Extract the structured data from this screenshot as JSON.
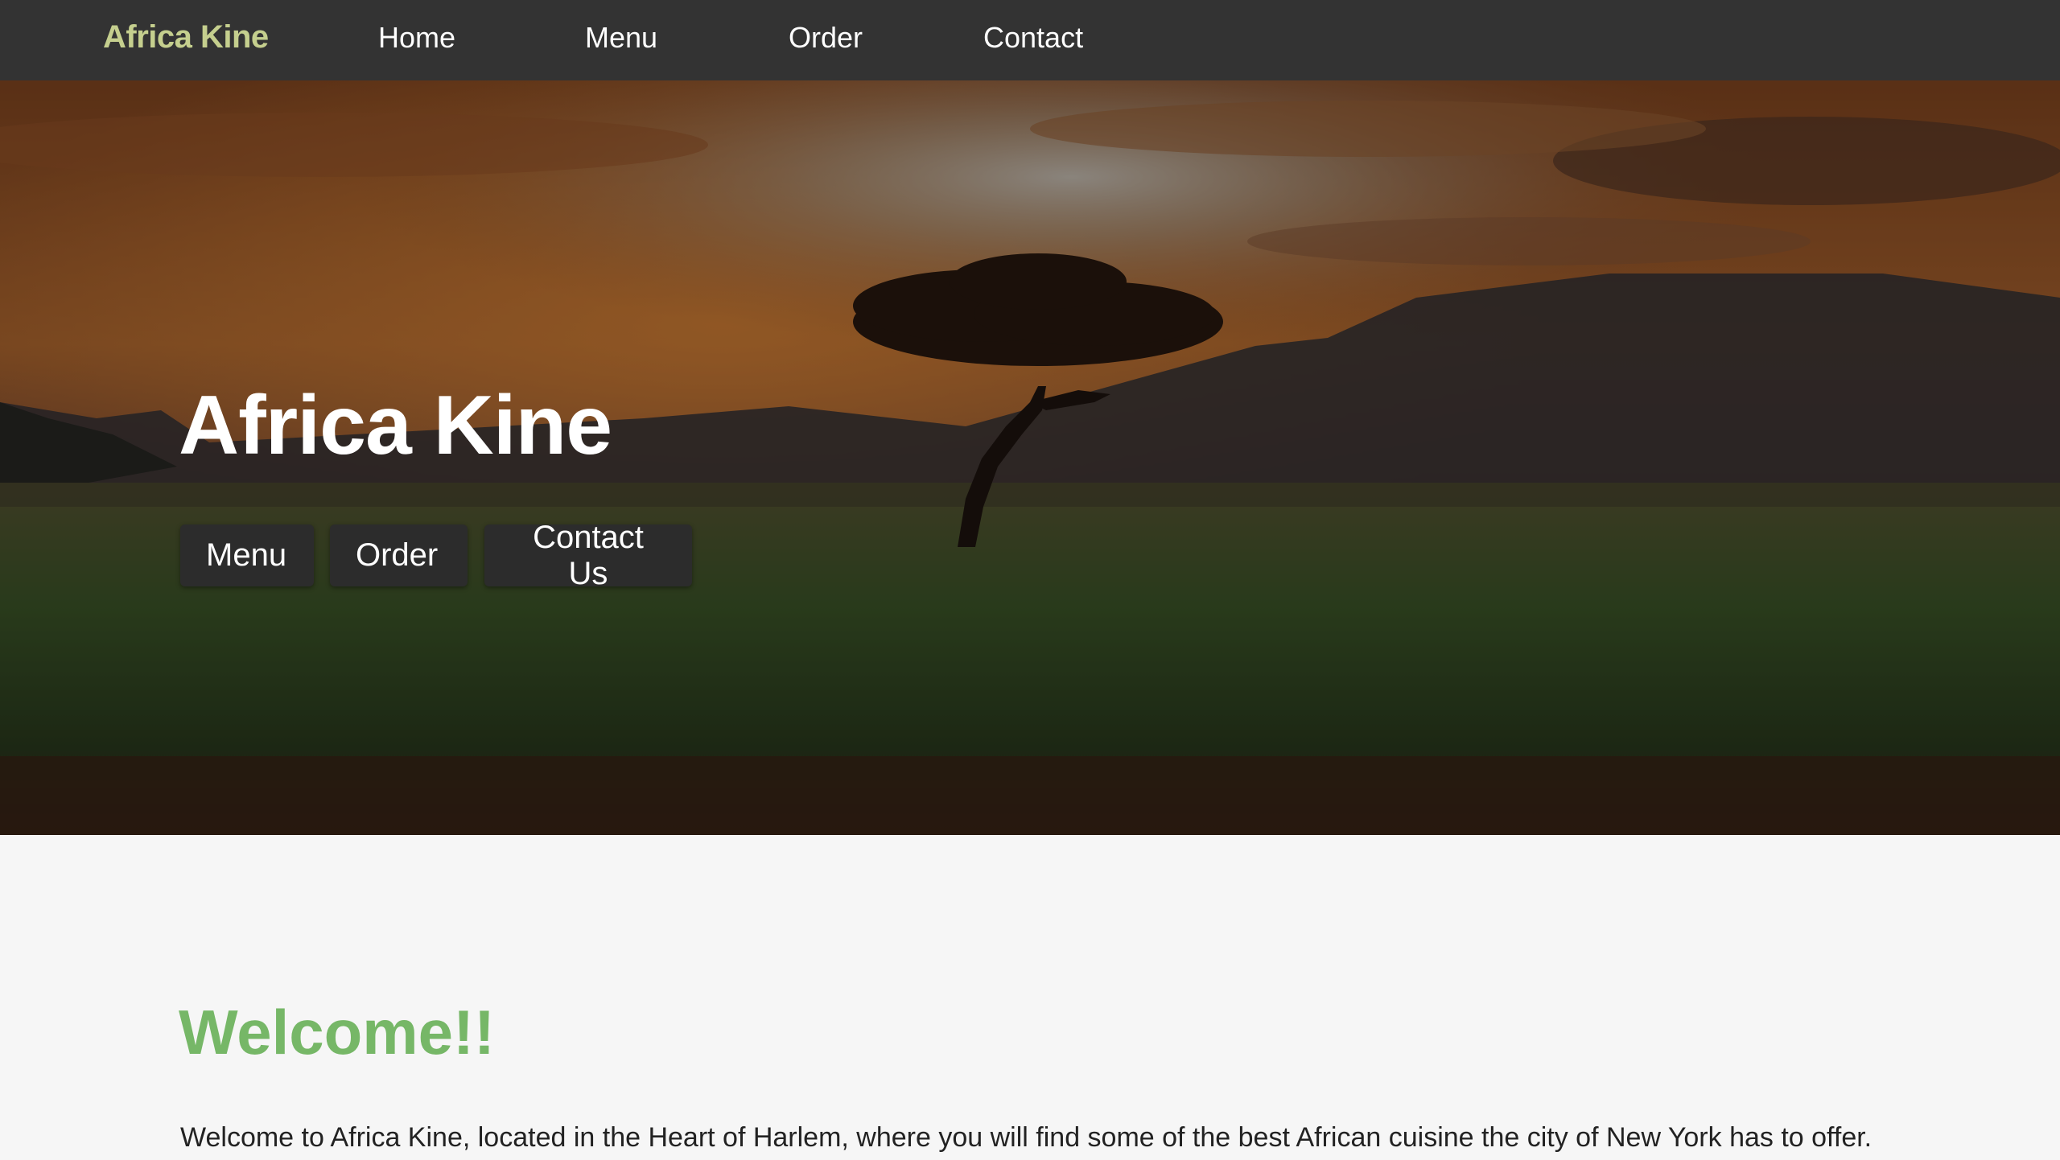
{
  "nav": {
    "brand": "Africa Kine",
    "links": [
      "Home",
      "Menu",
      "Order",
      "Contact"
    ]
  },
  "hero": {
    "title": "Africa Kine",
    "buttons": [
      "Menu",
      "Order",
      "Contact Us"
    ]
  },
  "welcome": {
    "title": "Welcome!!",
    "text": "Welcome to Africa Kine, located in the Heart of Harlem, where you will find some of the best African cuisine the city of New York has to offer."
  },
  "colors": {
    "navbar_bg": "#333333",
    "brand": "#c5cf8e",
    "welcome_title": "#76b767",
    "page_bg": "#f6f6f6",
    "button_bg": "#2c2c2c"
  }
}
